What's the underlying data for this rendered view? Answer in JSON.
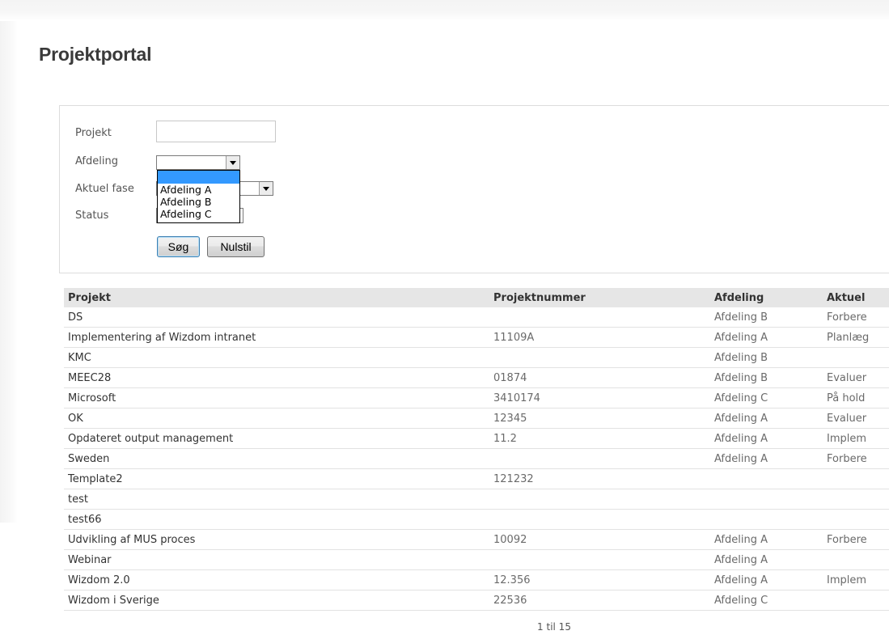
{
  "page": {
    "title": "Projektportal"
  },
  "search": {
    "fields": {
      "project": {
        "label": "Projekt",
        "value": ""
      },
      "department": {
        "label": "Afdeling",
        "value": ""
      },
      "phase": {
        "label": "Aktuel fase",
        "value": ""
      },
      "status": {
        "label": "Status",
        "value": ""
      }
    },
    "department_options": [
      "",
      "Afdeling A",
      "Afdeling B",
      "Afdeling C"
    ],
    "search_button": "Søg",
    "reset_button": "Nulstil"
  },
  "table": {
    "columns": [
      "Projekt",
      "Projektnummer",
      "Afdeling",
      "Aktuel"
    ],
    "rows": [
      [
        "DS",
        "",
        "Afdeling B",
        "Forbere"
      ],
      [
        "Implementering af Wizdom intranet",
        "11109A",
        "Afdeling A",
        "Planlæg"
      ],
      [
        "KMC",
        "",
        "Afdeling B",
        ""
      ],
      [
        "MEEC28",
        "01874",
        "Afdeling B",
        "Evaluer"
      ],
      [
        "Microsoft",
        "3410174",
        "Afdeling C",
        "På hold"
      ],
      [
        "OK",
        "12345",
        "Afdeling A",
        "Evaluer"
      ],
      [
        "Opdateret output management",
        "11.2",
        "Afdeling A",
        "Implem"
      ],
      [
        "Sweden",
        "",
        "Afdeling A",
        "Forbere"
      ],
      [
        "Template2",
        "121232",
        "",
        ""
      ],
      [
        "test",
        "",
        "",
        ""
      ],
      [
        "test66",
        "",
        "",
        ""
      ],
      [
        "Udvikling af MUS proces",
        "10092",
        "Afdeling A",
        "Forbere"
      ],
      [
        "Webinar",
        "",
        "Afdeling A",
        ""
      ],
      [
        "Wizdom 2.0",
        "12.356",
        "Afdeling A",
        "Implem"
      ],
      [
        "Wizdom i Sverige",
        "22536",
        "Afdeling C",
        ""
      ]
    ]
  },
  "pager": {
    "text": "1 til 15"
  },
  "colors": {
    "header_bg": "#e6e6e6",
    "dropdown_highlight": "#3399ff"
  }
}
